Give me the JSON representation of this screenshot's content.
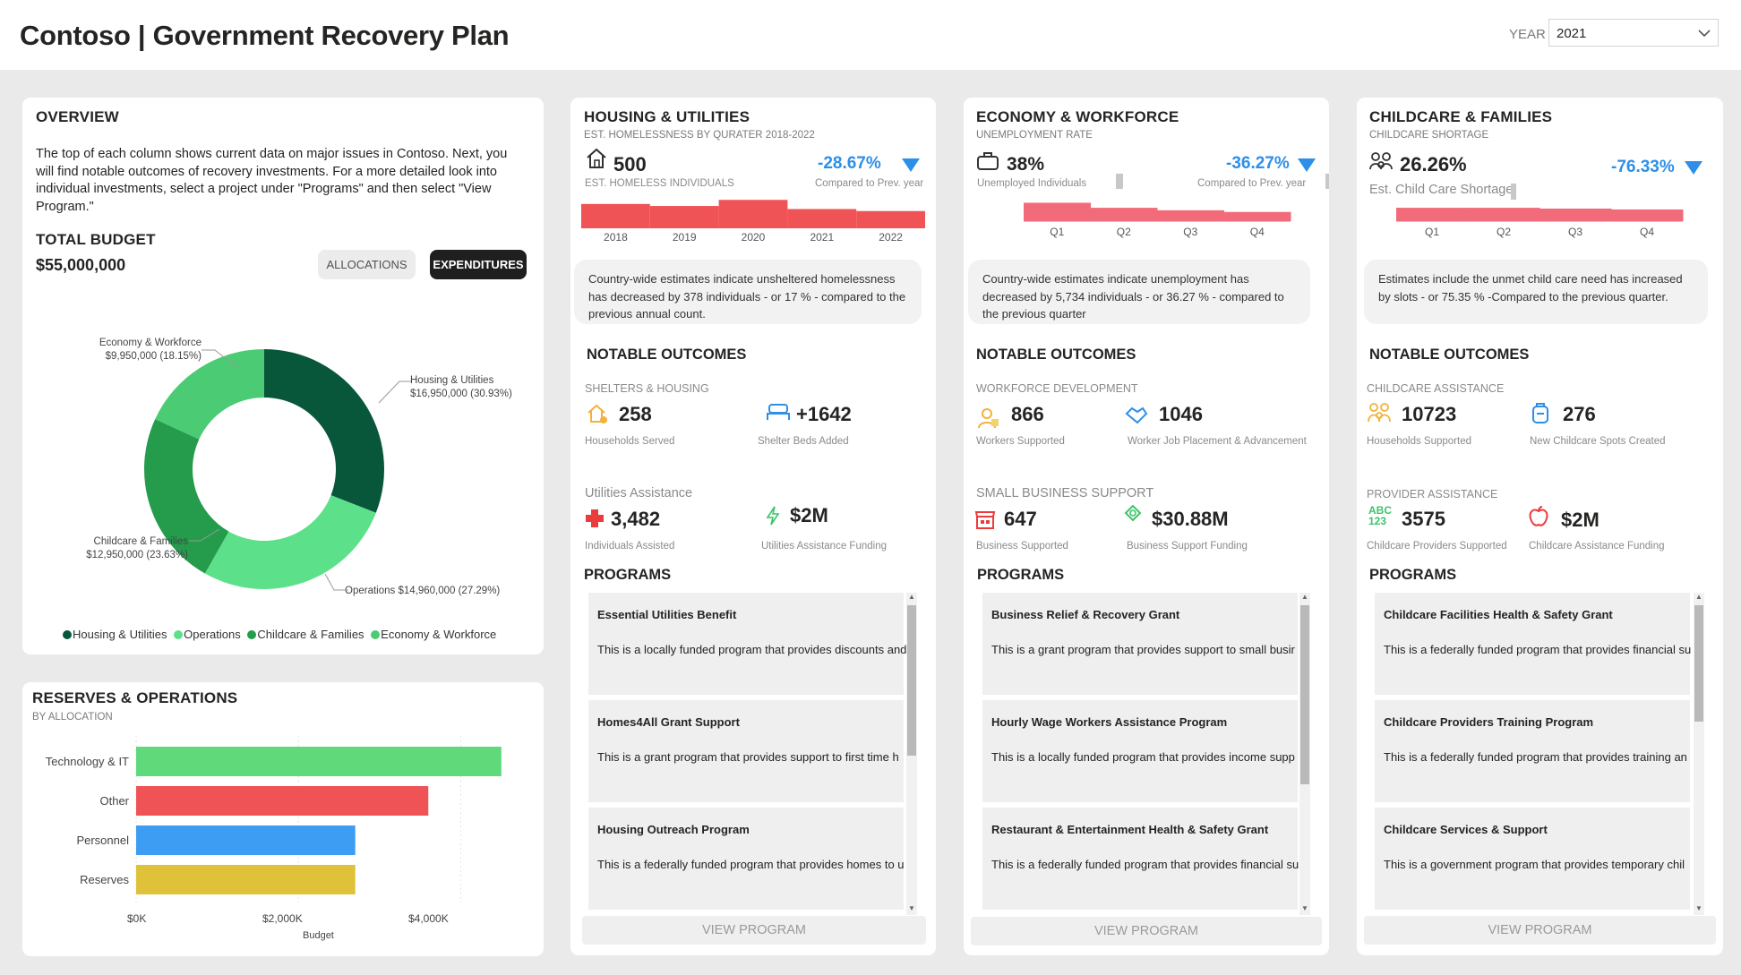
{
  "header": {
    "title": "Contoso | Government Recovery Plan",
    "year_label": "YEAR",
    "year_value": "2021"
  },
  "overview": {
    "title": "OVERVIEW",
    "text": "The top of each column shows current data on major issues in Contoso. Next, you will find notable outcomes of recovery investments. For a more detailed look into individual investments, select a project under \"Programs\" and then select \"View Program.\"",
    "budget_label": "TOTAL BUDGET",
    "budget_value": "$55,000,000",
    "btn_allocations": "ALLOCATIONS",
    "btn_expenditures": "EXPENDITURES",
    "donut": {
      "slices": [
        {
          "name": "Housing & Utilities",
          "value": 16950000,
          "label": "$16,950,000 (30.93%)",
          "color": "#08573a"
        },
        {
          "name": "Operations",
          "value": 14960000,
          "label": "$14,960,000 (27.29%)",
          "color": "#5de08a"
        },
        {
          "name": "Childcare & Families",
          "value": 12950000,
          "label": "$12,950,000 (23.63%)",
          "color": "#249c4c"
        },
        {
          "name": "Economy & Workforce",
          "value": 9950000,
          "label": "$9,950,000 (18.15%)",
          "color": "#4bcb73"
        }
      ],
      "label_operations": "Operations $14,960,000 (27.29%)"
    },
    "legend": [
      "Housing & Utilities",
      "Operations",
      "Childcare & Families",
      "Economy & Workforce"
    ]
  },
  "reserves": {
    "title": "RESERVES & OPERATIONS",
    "subtitle": "BY ALLOCATION",
    "xlabel": "Budget",
    "xticks": [
      "$0K",
      "$2,000K",
      "$4,000K"
    ]
  },
  "chart_data": [
    {
      "type": "bar",
      "orientation": "horizontal",
      "title": "RESERVES & OPERATIONS",
      "subtitle": "BY ALLOCATION",
      "categories": [
        "Technology & IT",
        "Other",
        "Personnel",
        "Reserves"
      ],
      "values": [
        4500,
        3600,
        2700,
        2700
      ],
      "colors": [
        "#5fd97a",
        "#f05356",
        "#3d9df2",
        "#e0c23a"
      ],
      "xlabel": "Budget",
      "xlim": [
        0,
        4800
      ],
      "xticks": [
        "$0K",
        "$2,000K",
        "$4,000K"
      ]
    },
    {
      "type": "bar",
      "title": "EST. HOMELESSNESS BY QURATER 2018-2022",
      "categories": [
        "2018",
        "2019",
        "2020",
        "2021",
        "2022"
      ],
      "values": [
        24,
        22,
        28,
        19,
        17
      ],
      "ylim": [
        0,
        30
      ]
    },
    {
      "type": "area",
      "title": "UNEMPLOYMENT RATE",
      "categories": [
        "Q1",
        "Q2",
        "Q3",
        "Q4"
      ],
      "values": [
        22,
        16,
        13,
        11
      ],
      "ylim": [
        0,
        30
      ]
    },
    {
      "type": "area",
      "title": "CHILDCARE SHORTAGE",
      "categories": [
        "Q1",
        "Q2",
        "Q3",
        "Q4"
      ],
      "values": [
        16,
        16,
        15,
        14
      ],
      "ylim": [
        0,
        30
      ]
    }
  ],
  "housing": {
    "title": "HOUSING & UTILITIES",
    "subtitle": "EST. HOMELESSNESS BY QURATER 2018-2022",
    "kpi_value": "500",
    "kpi_caption": "EST. HOMELESS INDIVIDUALS",
    "pct": "-28.67%",
    "pct_caption": "Compared to Prev. year",
    "note": "Country-wide estimates indicate unsheltered homelessness has decreased by 378 individuals - or 17 % - compared to the previous annual count.",
    "outcomes_title": "NOTABLE OUTCOMES",
    "cat1": "SHELTERS & HOUSING",
    "m1": "258",
    "m1_cap": "Households Served",
    "m2": "+1642",
    "m2_cap": "Shelter Beds Added",
    "cat2": "Utilities Assistance",
    "m3": "3,482",
    "m3_cap": "Individuals Assisted",
    "m4": "$2M",
    "m4_cap": "Utilities Assistance Funding",
    "programs_title": "PROGRAMS",
    "programs": [
      {
        "title": "Essential Utilities Benefit",
        "desc": "This is a locally funded program that provides discounts and participants."
      },
      {
        "title": "Homes4All Grant Support",
        "desc": "This is a grant program that provides support to first time h"
      },
      {
        "title": "Housing Outreach Program",
        "desc": "This is a federally funded program that provides homes to u"
      }
    ],
    "view_btn": "VIEW PROGRAM"
  },
  "economy": {
    "title": "ECONOMY & WORKFORCE",
    "subtitle": "UNEMPLOYMENT RATE",
    "kpi_value": "38%",
    "kpi_caption": "Unemployed Individuals",
    "pct": "-36.27%",
    "pct_caption": "Compared to Prev. year",
    "note": "Country-wide estimates indicate unemployment has decreased by 5,734  individuals - or 36.27 % - compared to the previous quarter",
    "outcomes_title": "NOTABLE OUTCOMES",
    "cat1": "WORKFORCE DEVELOPMENT",
    "m1": "866",
    "m1_cap": "Workers Supported",
    "m2": "1046",
    "m2_cap": "Worker Job Placement & Advancement",
    "cat2": "SMALL BUSINESS SUPPORT",
    "m3": "647",
    "m3_cap": "Business Supported",
    "m4": "$30.88M",
    "m4_cap": "Business Support Funding",
    "programs_title": "PROGRAMS",
    "programs": [
      {
        "title": "Business Relief & Recovery Grant",
        "desc": "This is a grant program that provides support to small busir"
      },
      {
        "title": "Hourly Wage Workers Assistance Program",
        "desc": "This is a locally funded program that provides income supp"
      },
      {
        "title": "Restaurant & Entertainment Health & Safety Grant",
        "desc": "This is a federally funded program that provides financial su sanitation."
      }
    ],
    "view_btn": "VIEW PROGRAM"
  },
  "childcare": {
    "title": "CHILDCARE & FAMILIES",
    "subtitle": "CHILDCARE SHORTAGE",
    "kpi_value": "26.26%",
    "kpi_caption": "Est. Child Care Shortage",
    "pct": "-76.33%",
    "note": "Estimates include the unmet child  care need has increased by  slots - or 75.35 % -Compared to the previous quarter.",
    "outcomes_title": "NOTABLE OUTCOMES",
    "cat1": "CHILDCARE ASSISTANCE",
    "m1": "10723",
    "m1_cap": "Households Supported",
    "m2": "276",
    "m2_cap": "New Childcare Spots Created",
    "cat2": "PROVIDER ASSISTANCE",
    "m3": "3575",
    "m3_cap": "Childcare Providers Supported",
    "m4": "$2M",
    "m4_cap": "Childcare Assistance Funding",
    "programs_title": "PROGRAMS",
    "programs": [
      {
        "title": "Childcare Facilities Health & Safety Grant",
        "desc": "This is a federally funded program that provides financial su sanitation."
      },
      {
        "title": "Childcare Providers Training Program",
        "desc": "This is a federally funded program that provides training an"
      },
      {
        "title": "Childcare Services & Support",
        "desc": "This is a government program that provides temporary chil"
      }
    ],
    "view_btn": "VIEW PROGRAM"
  },
  "icons": {
    "house": "house-icon",
    "briefcase": "briefcase-icon",
    "family": "family-icon",
    "bed": "bed-icon",
    "medical": "medical-cross-icon",
    "bolt": "lightning-icon"
  },
  "colors": {
    "accent_blue": "#2d8fe8",
    "bar_red": "#f05356",
    "orange": "#f3b23a"
  }
}
